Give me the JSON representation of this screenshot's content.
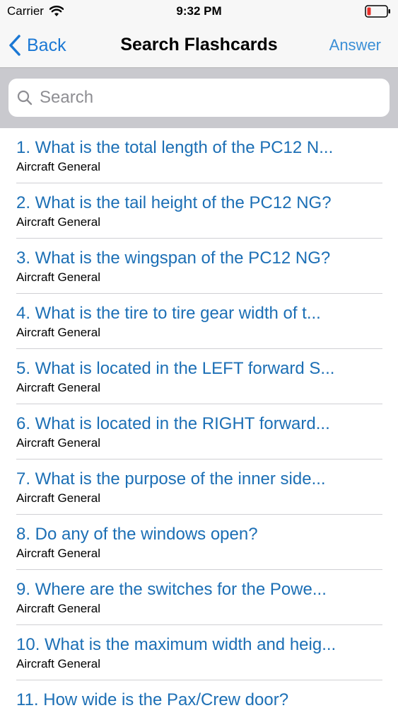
{
  "status_bar": {
    "carrier": "Carrier",
    "time": "9:32 PM",
    "battery_color": "#e8302a"
  },
  "nav": {
    "back_label": "Back",
    "title": "Search Flashcards",
    "answer_label": "Answer",
    "accent_color": "#1b78d4"
  },
  "search": {
    "placeholder": "Search",
    "value": ""
  },
  "flashcards": [
    {
      "question": "1. What is the total length of the PC12 N...",
      "category": "Aircraft General"
    },
    {
      "question": "2. What is the tail height of the PC12 NG?",
      "category": "Aircraft General"
    },
    {
      "question": "3. What is the wingspan of the PC12 NG?",
      "category": "Aircraft General"
    },
    {
      "question": "4. What is the tire to tire gear width of t...",
      "category": "Aircraft General"
    },
    {
      "question": "5. What is located in the LEFT forward S...",
      "category": "Aircraft General"
    },
    {
      "question": "6. What is located in the RIGHT forward...",
      "category": "Aircraft General"
    },
    {
      "question": "7. What is the purpose of the inner side...",
      "category": "Aircraft General"
    },
    {
      "question": "8. Do any of the windows open?",
      "category": "Aircraft General"
    },
    {
      "question": "9. Where are the switches for the  Powe...",
      "category": "Aircraft General"
    },
    {
      "question": "10. What is the maximum width and heig...",
      "category": "Aircraft General"
    },
    {
      "question": "11. How wide is the Pax/Crew door?",
      "category": ""
    }
  ]
}
